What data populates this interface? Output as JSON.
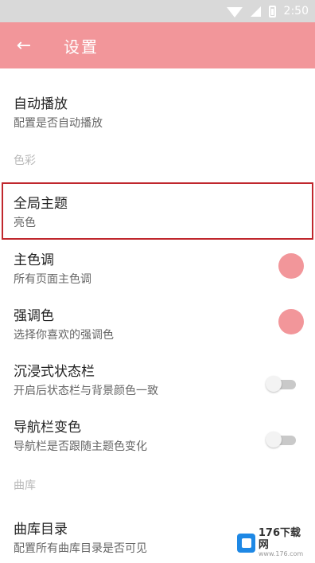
{
  "status_bar": {
    "time": "2:50"
  },
  "toolbar": {
    "title": "设置",
    "back_label": "←"
  },
  "settings": {
    "autoplay": {
      "title": "自动播放",
      "subtitle": "配置是否自动播放"
    },
    "section_color": "色彩",
    "global_theme": {
      "title": "全局主题",
      "subtitle": "亮色"
    },
    "primary_color": {
      "title": "主色调",
      "subtitle": "所有页面主色调",
      "swatch_color": "#f2969a"
    },
    "accent_color": {
      "title": "强调色",
      "subtitle": "选择你喜欢的强调色",
      "swatch_color": "#f2969a"
    },
    "immersive_status": {
      "title": "沉浸式状态栏",
      "subtitle": "开启后状态栏与背景颜色一致",
      "enabled": false
    },
    "navbar_color": {
      "title": "导航栏变色",
      "subtitle": "导航栏是否跟随主题色变化",
      "enabled": false
    },
    "section_library": "曲库",
    "library_dirs": {
      "title": "曲库目录",
      "subtitle": "配置所有曲库目录是否可见"
    }
  },
  "watermark": {
    "main": "176下载网",
    "url": "www.176.com"
  },
  "colors": {
    "accent": "#f2969a",
    "highlight": "#c0272d"
  }
}
